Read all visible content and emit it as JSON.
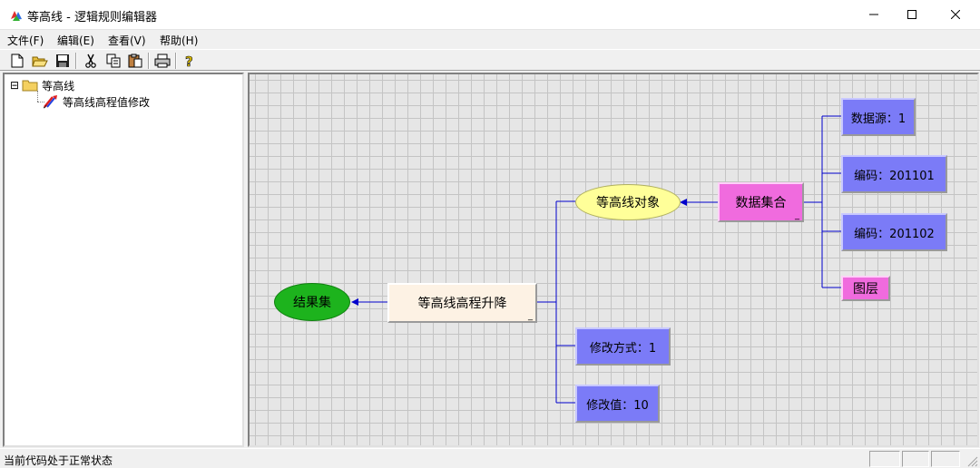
{
  "window": {
    "title": "等高线 - 逻辑规则编辑器"
  },
  "menu": {
    "items": [
      "文件(F)",
      "编辑(E)",
      "查看(V)",
      "帮助(H)"
    ]
  },
  "toolbar": {
    "buttons": [
      "new-file-icon",
      "open-folder-icon",
      "save-icon",
      "cut-icon",
      "copy-icon",
      "paste-icon",
      "print-icon",
      "help-icon"
    ]
  },
  "tree": {
    "expander": "⊟",
    "root_label": "等高线",
    "child_label": "等高线高程值修改"
  },
  "diagram": {
    "nodes": {
      "result": "结果集",
      "contour_elevation": "等高线高程升降",
      "contour_object": "等高线对象",
      "data_collection": "数据集合",
      "data_source": "数据源：1",
      "code_1": "编码：201101",
      "code_2": "编码：201102",
      "layer": "图层",
      "modify_mode": "修改方式：1",
      "modify_value": "修改值：10"
    },
    "colors": {
      "edge": "#0000cc",
      "rect_blue": "#7b7bf7",
      "rect_pink": "#f06bde",
      "ellipse_yellow": "#ffff99",
      "ellipse_green": "#1db31d",
      "rect_cream": "#fdf2e4"
    }
  },
  "status": {
    "text": "当前代码处于正常状态"
  }
}
